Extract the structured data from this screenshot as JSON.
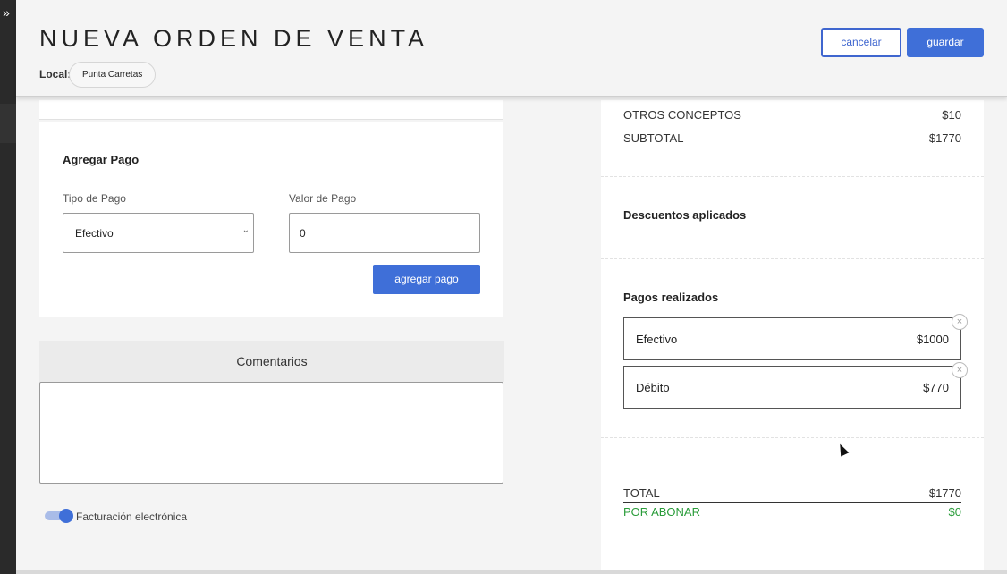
{
  "sidebar": {
    "expand_glyph": "»",
    "expand_icon": "double-chevron-right-icon"
  },
  "header": {
    "title": "NUEVA ORDEN DE VENTA",
    "local_label": "Local:",
    "local_value": "Punta Carretas",
    "cancel_label": "cancelar",
    "save_label": "guardar"
  },
  "payment_form": {
    "title": "Agregar Pago",
    "type_label": "Tipo de Pago",
    "type_value": "Efectivo",
    "type_chevron": "⌄",
    "value_label": "Valor de Pago",
    "value_value": "0",
    "add_label": "agregar pago"
  },
  "comments": {
    "label": "Comentarios",
    "value": ""
  },
  "invoice_toggle": {
    "label": "Facturación electrónica",
    "on": true
  },
  "summary": {
    "rows": [
      {
        "label": "OTROS CONCEPTOS",
        "amount": "$10"
      },
      {
        "label": "SUBTOTAL",
        "amount": "$1770"
      }
    ],
    "discounts_title": "Descuentos aplicados",
    "payments_title": "Pagos realizados",
    "payments": [
      {
        "method": "Efectivo",
        "amount": "$1000"
      },
      {
        "method": "Débito",
        "amount": "$770"
      }
    ],
    "remove_glyph": "×",
    "total_label": "TOTAL",
    "total_amount": "$1770",
    "pending_label": "POR ABONAR",
    "pending_amount": "$0"
  },
  "colors": {
    "accent": "#3f6fd8",
    "pending": "#2a9c3a"
  }
}
